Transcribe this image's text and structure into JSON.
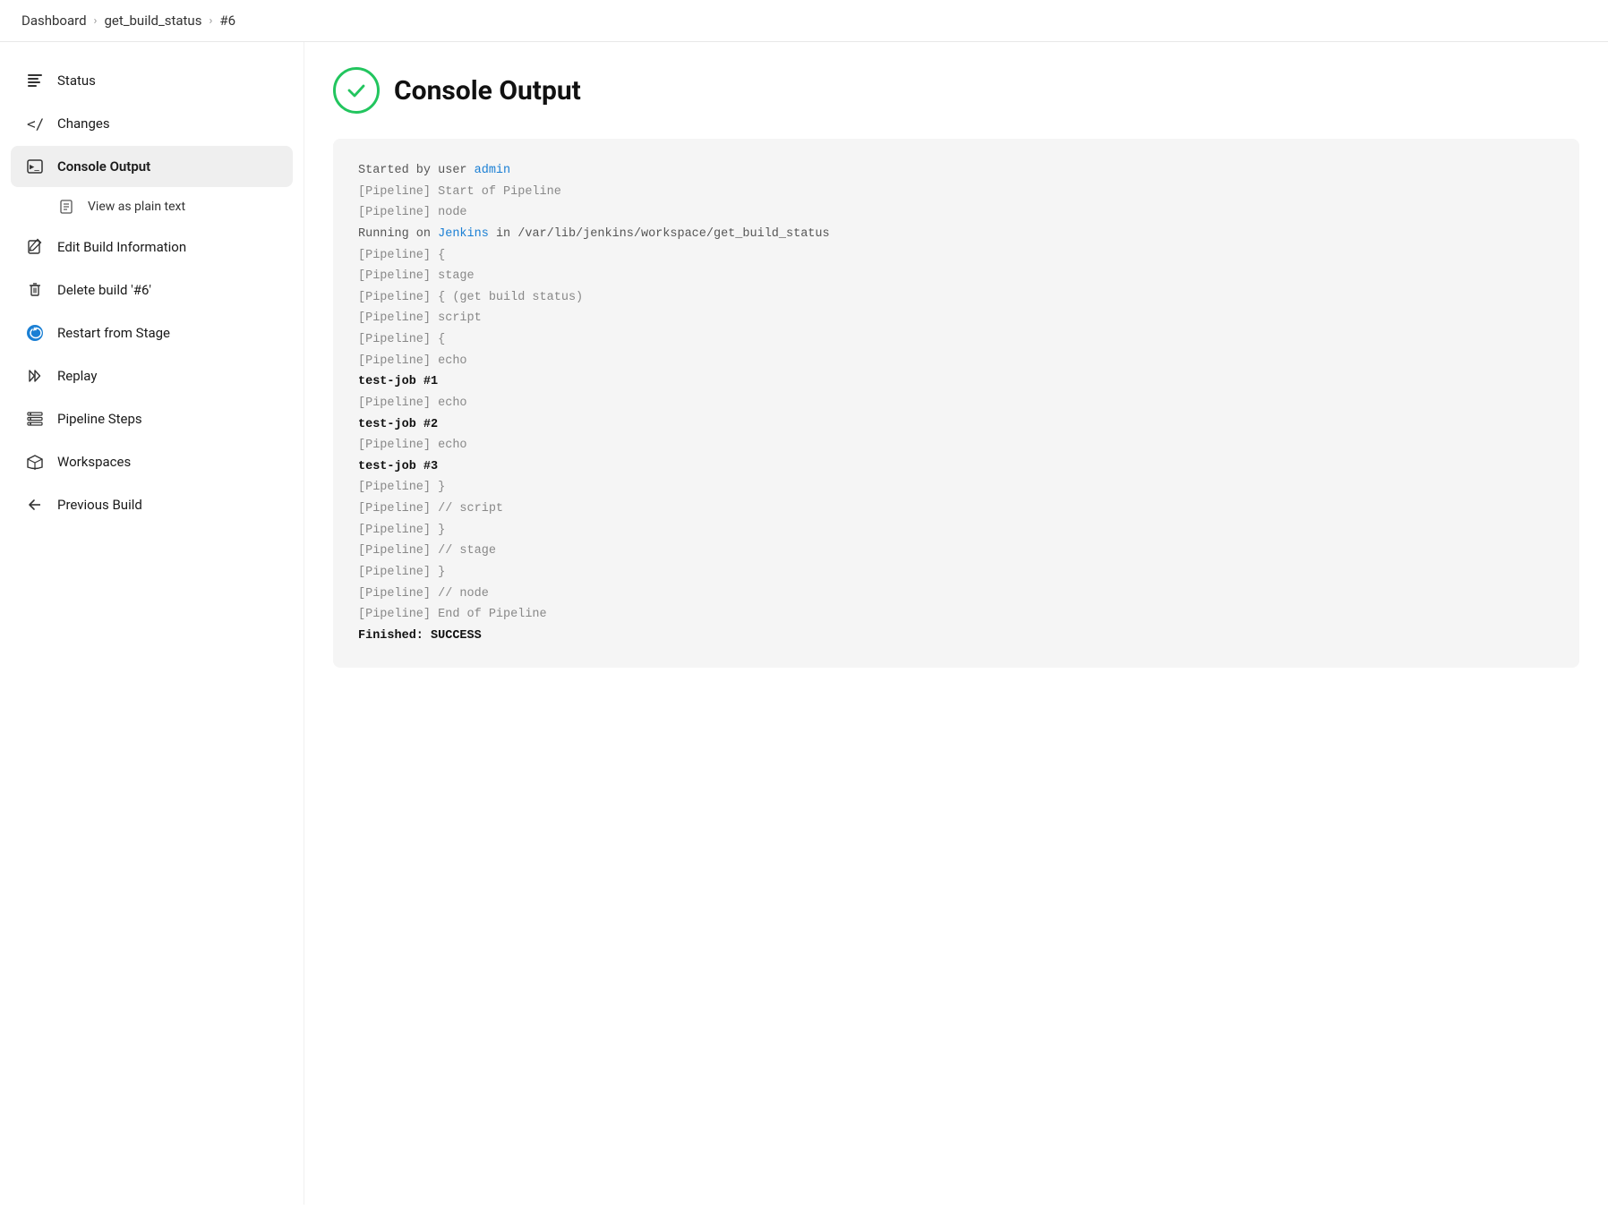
{
  "breadcrumb": {
    "items": [
      "Dashboard",
      "get_build_status",
      "#6"
    ],
    "separators": [
      ">",
      ">"
    ]
  },
  "sidebar": {
    "items": [
      {
        "id": "status",
        "label": "Status",
        "icon": "status",
        "active": false,
        "indent": false
      },
      {
        "id": "changes",
        "label": "Changes",
        "icon": "changes",
        "active": false,
        "indent": false
      },
      {
        "id": "console-output",
        "label": "Console Output",
        "icon": "console",
        "active": true,
        "indent": false
      },
      {
        "id": "view-plain-text",
        "label": "View as plain text",
        "icon": "plain-text",
        "active": false,
        "indent": true
      },
      {
        "id": "edit-build",
        "label": "Edit Build Information",
        "icon": "edit",
        "active": false,
        "indent": false
      },
      {
        "id": "delete-build",
        "label": "Delete build '#6'",
        "icon": "delete",
        "active": false,
        "indent": false
      },
      {
        "id": "restart-stage",
        "label": "Restart from Stage",
        "icon": "restart",
        "active": false,
        "indent": false
      },
      {
        "id": "replay",
        "label": "Replay",
        "icon": "replay",
        "active": false,
        "indent": false
      },
      {
        "id": "pipeline-steps",
        "label": "Pipeline Steps",
        "icon": "pipeline-steps",
        "active": false,
        "indent": false
      },
      {
        "id": "workspaces",
        "label": "Workspaces",
        "icon": "workspaces",
        "active": false,
        "indent": false
      },
      {
        "id": "previous-build",
        "label": "Previous Build",
        "icon": "previous",
        "active": false,
        "indent": false
      }
    ]
  },
  "main": {
    "title": "Console Output",
    "console_lines": [
      {
        "text": "Started by user admin",
        "type": "normal",
        "admin_link": true
      },
      {
        "text": "[Pipeline] Start of Pipeline",
        "type": "muted"
      },
      {
        "text": "[Pipeline] node",
        "type": "muted"
      },
      {
        "text": "Running on Jenkins in /var/lib/jenkins/workspace/get_build_status",
        "type": "normal",
        "jenkins_link": true
      },
      {
        "text": "[Pipeline] {",
        "type": "muted"
      },
      {
        "text": "[Pipeline] stage",
        "type": "muted"
      },
      {
        "text": "[Pipeline] { (get build status)",
        "type": "muted"
      },
      {
        "text": "[Pipeline] script",
        "type": "muted"
      },
      {
        "text": "[Pipeline] {",
        "type": "muted"
      },
      {
        "text": "[Pipeline] echo",
        "type": "muted"
      },
      {
        "text": "test-job #1",
        "type": "bold"
      },
      {
        "text": "[Pipeline] echo",
        "type": "muted"
      },
      {
        "text": "test-job #2",
        "type": "bold"
      },
      {
        "text": "[Pipeline] echo",
        "type": "muted"
      },
      {
        "text": "test-job #3",
        "type": "bold"
      },
      {
        "text": "[Pipeline] }",
        "type": "muted"
      },
      {
        "text": "[Pipeline] // script",
        "type": "muted"
      },
      {
        "text": "[Pipeline] }",
        "type": "muted"
      },
      {
        "text": "[Pipeline] // stage",
        "type": "muted"
      },
      {
        "text": "[Pipeline] }",
        "type": "muted"
      },
      {
        "text": "[Pipeline] // node",
        "type": "muted"
      },
      {
        "text": "[Pipeline] End of Pipeline",
        "type": "muted"
      },
      {
        "text": "Finished: SUCCESS",
        "type": "bold"
      }
    ]
  }
}
